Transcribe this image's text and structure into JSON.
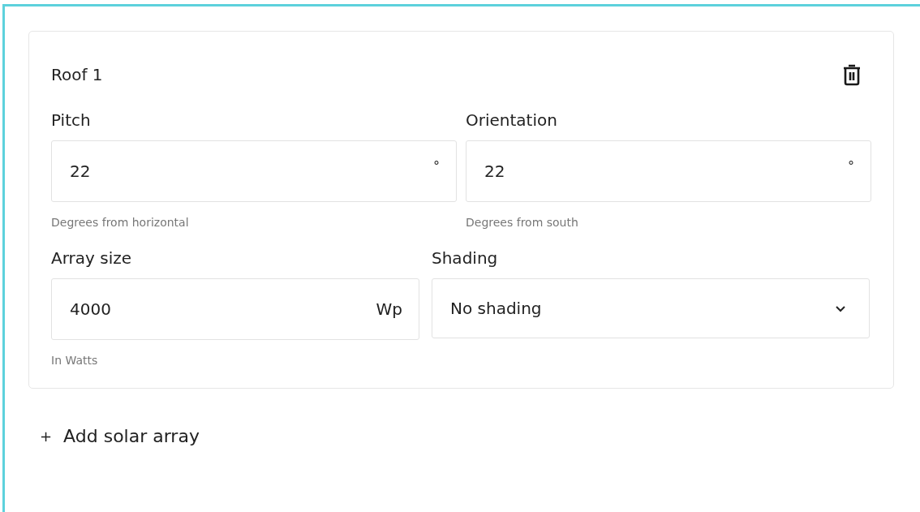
{
  "roof": {
    "title": "Roof 1",
    "rows": [
      [
        {
          "kind": "text",
          "label": "Pitch",
          "value": "22",
          "unit": "°",
          "hint": "Degrees from horizontal"
        },
        {
          "kind": "text",
          "label": "Orientation",
          "value": "22",
          "unit": "°",
          "hint": "Degrees from south"
        }
      ],
      [
        {
          "kind": "text",
          "label": "Array size",
          "value": "4000",
          "unit": "Wp",
          "hint": "In Watts"
        },
        {
          "kind": "select",
          "label": "Shading",
          "value": "No shading"
        }
      ]
    ]
  },
  "add_button": {
    "icon": "+",
    "label": "Add solar array"
  }
}
